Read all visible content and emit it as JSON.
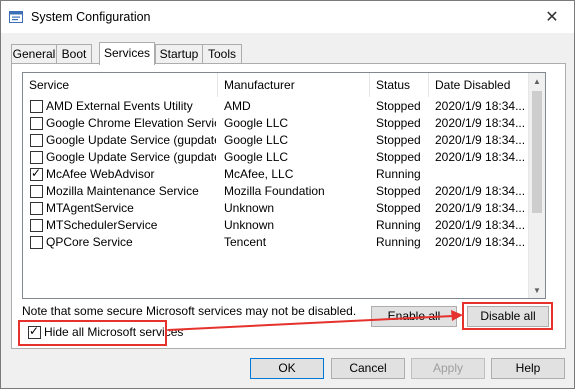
{
  "window": {
    "title": "System Configuration",
    "close_glyph": "✕"
  },
  "tabs": [
    {
      "label": "General",
      "active": false
    },
    {
      "label": "Boot",
      "active": false
    },
    {
      "label": "Services",
      "active": true
    },
    {
      "label": "Startup",
      "active": false
    },
    {
      "label": "Tools",
      "active": false
    }
  ],
  "services_table": {
    "columns": [
      "Service",
      "Manufacturer",
      "Status",
      "Date Disabled"
    ],
    "rows": [
      {
        "checked": false,
        "service": "AMD External Events Utility",
        "manufacturer": "AMD",
        "status": "Stopped",
        "date_disabled": "2020/1/9 18:34..."
      },
      {
        "checked": false,
        "service": "Google Chrome Elevation Service",
        "manufacturer": "Google LLC",
        "status": "Stopped",
        "date_disabled": "2020/1/9 18:34..."
      },
      {
        "checked": false,
        "service": "Google Update Service (gupdate)",
        "manufacturer": "Google LLC",
        "status": "Stopped",
        "date_disabled": "2020/1/9 18:34..."
      },
      {
        "checked": false,
        "service": "Google Update Service (gupdatem)",
        "manufacturer": "Google LLC",
        "status": "Stopped",
        "date_disabled": "2020/1/9 18:34..."
      },
      {
        "checked": true,
        "service": "McAfee WebAdvisor",
        "manufacturer": "McAfee, LLC",
        "status": "Running",
        "date_disabled": ""
      },
      {
        "checked": false,
        "service": "Mozilla Maintenance Service",
        "manufacturer": "Mozilla Foundation",
        "status": "Stopped",
        "date_disabled": "2020/1/9 18:34..."
      },
      {
        "checked": false,
        "service": "MTAgentService",
        "manufacturer": "Unknown",
        "status": "Stopped",
        "date_disabled": "2020/1/9 18:34..."
      },
      {
        "checked": false,
        "service": "MTSchedulerService",
        "manufacturer": "Unknown",
        "status": "Running",
        "date_disabled": "2020/1/9 18:34..."
      },
      {
        "checked": false,
        "service": "QPCore Service",
        "manufacturer": "Tencent",
        "status": "Running",
        "date_disabled": "2020/1/9 18:34..."
      }
    ]
  },
  "note": "Note that some secure Microsoft services may not be disabled.",
  "enable_all_label": "Enable all",
  "disable_all_label": "Disable all",
  "hide_ms_services": {
    "label": "Hide all Microsoft services",
    "checked": true
  },
  "dialog_buttons": {
    "ok": "OK",
    "cancel": "Cancel",
    "apply": "Apply",
    "help": "Help"
  },
  "colors": {
    "annotation_red": "#e5322d"
  }
}
